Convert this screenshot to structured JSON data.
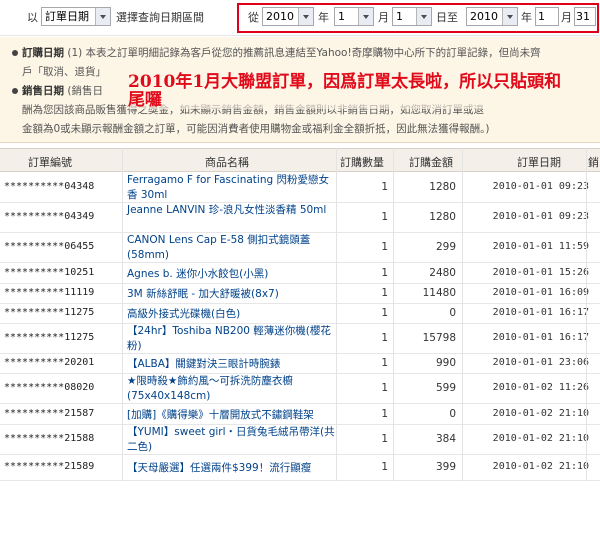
{
  "filter": {
    "by_label": "以",
    "by_select": "訂單日期",
    "by_suffix": "選擇查詢日期區間",
    "from_label": "從",
    "from_year": "2010",
    "year_label": "年",
    "from_month": "1",
    "month_label": "月",
    "from_day": "1",
    "to_label": "日至",
    "to_year": "2010",
    "to_month": "1",
    "to_day": "31",
    "day_label": "日"
  },
  "info": {
    "line1_title": "訂購日期",
    "line1_text": "(1) 本表之訂單明細記錄為客戶從您的推薦訊息連結至Yahoo!奇摩購物中心所下的訂單記錄，但尚未齊",
    "line2_text": "戶「取消、退貨」",
    "line3_title": "銷售日期",
    "line3_text": "(銷售日",
    "line4_text": "酬為您因該商品販售獲得之獎金，如未顯示銷售金額，銷售金額則以非銷售日期，如您取消訂單或退",
    "line5_text": "金額為0或未顯示報酬金額之訂單，可能因消費者使用購物金或福利金全額折抵，因此無法獲得報酬。)",
    "overlay_line1": "2010年1月大聯盟訂單，因爲訂單太長啦，所以只貼頭和",
    "overlay_line2": "尾囉"
  },
  "table": {
    "headers": [
      "訂單編號",
      "商品名稱",
      "訂購數量",
      "訂購金額",
      "訂單日期",
      "銷"
    ],
    "rows": [
      {
        "order_id": "**********04348",
        "product": "Ferragamo F for Fascinating 閃粉愛戀女香 30ml",
        "qty": "1",
        "amount": "1280",
        "date": "2010-01-01 09:23"
      },
      {
        "order_id": "**********04349",
        "product": "Jeanne LANVIN 珍-浪凡女性淡香精 50ml",
        "qty": "1",
        "amount": "1280",
        "date": "2010-01-01 09:23"
      },
      {
        "order_id": "**********06455",
        "product": "CANON Lens Cap E-58 側扣式鏡頭蓋(58mm)",
        "qty": "1",
        "amount": "299",
        "date": "2010-01-01 11:59"
      },
      {
        "order_id": "**********10251",
        "product": "Agnes b. 迷你小水餃包(小黑)",
        "qty": "1",
        "amount": "2480",
        "date": "2010-01-01 15:26"
      },
      {
        "order_id": "**********11119",
        "product": "3M 新絲舒眠 - 加大舒暖被(8x7)",
        "qty": "1",
        "amount": "11480",
        "date": "2010-01-01 16:09"
      },
      {
        "order_id": "**********11275",
        "product": "高級外接式光碟機(白色)",
        "qty": "1",
        "amount": "0",
        "date": "2010-01-01 16:17"
      },
      {
        "order_id": "**********11275",
        "product": "【24hr】Toshiba NB200 輕薄迷你機(櫻花粉)",
        "qty": "1",
        "amount": "15798",
        "date": "2010-01-01 16:17"
      },
      {
        "order_id": "**********20201",
        "product": "【ALBA】關鍵對決三眼計時腕錶",
        "qty": "1",
        "amount": "990",
        "date": "2010-01-01 23:06"
      },
      {
        "order_id": "**********08020",
        "product": "★限時殺★飾約風～可拆洗防塵衣櫥(75x40x148cm)",
        "qty": "1",
        "amount": "599",
        "date": "2010-01-02 11:26"
      },
      {
        "order_id": "**********21587",
        "product": "[加購]《購得樂》十層開放式不鏽鋼鞋架",
        "qty": "1",
        "amount": "0",
        "date": "2010-01-02 21:10"
      },
      {
        "order_id": "**********21588",
        "product": "【YUMI】sweet girl・日貨兔毛絨吊帶洋(共二色)",
        "qty": "1",
        "amount": "384",
        "date": "2010-01-02 21:10"
      },
      {
        "order_id": "**********21589",
        "product": "【天母嚴選】任選兩件$399！流行顯瘦",
        "qty": "1",
        "amount": "399",
        "date": "2010-01-02 21:10"
      }
    ]
  },
  "colors": {
    "highlight_red": "#e0001a",
    "info_bg": "#fdf5e6",
    "link_blue": "#00428a",
    "header_bg": "#f4f0e9"
  }
}
